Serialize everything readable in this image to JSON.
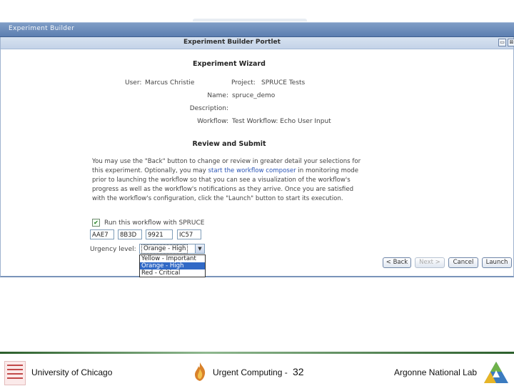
{
  "window": {
    "title": "Experiment Builder"
  },
  "portlet": {
    "title": "Experiment Builder Portlet",
    "minimize_glyph": "▭",
    "close_glyph": "⊠"
  },
  "wizard": {
    "title": "Experiment Wizard",
    "user_label": "User:",
    "user_value": "Marcus Christie",
    "project_label": "Project:",
    "project_value": "SPRUCE Tests",
    "name_label": "Name:",
    "name_value": "spruce_demo",
    "description_label": "Description:",
    "description_value": "",
    "workflow_label": "Workflow:",
    "workflow_value": "Test Workflow: Echo User Input"
  },
  "review": {
    "title": "Review and Submit",
    "para_part1": "You may use the \"Back\" button to change or review in greater detail your selections for this experiment. Optionally, you may ",
    "para_link": "start the workflow composer",
    "para_part2": " in monitoring mode prior to launching the workflow so that you can see a visualization of the workflow's progress as well as the workflow's notifications as they arrive. Once you are satisfied with the workflow's configuration, click the \"Launch\" button to start its execution."
  },
  "spruce": {
    "checkbox_label": "Run this workflow with SPRUCE",
    "checked_glyph": "✔",
    "token_fields": [
      "AAE7",
      "8B3D",
      "9921",
      "IC57"
    ],
    "urgency_label": "Urgency level:",
    "urgency_selected": "Orange - High",
    "urgency_options": [
      "Yellow - Important",
      "Orange - High",
      "Red - Critical"
    ],
    "dropdown_arrow": "▼"
  },
  "buttons": {
    "back": "< Back",
    "next": "Next >",
    "cancel": "Cancel",
    "launch": "Launch"
  },
  "footer": {
    "left": "University of Chicago",
    "center": "Urgent Computing -",
    "page": "32",
    "right": "Argonne National Lab"
  }
}
